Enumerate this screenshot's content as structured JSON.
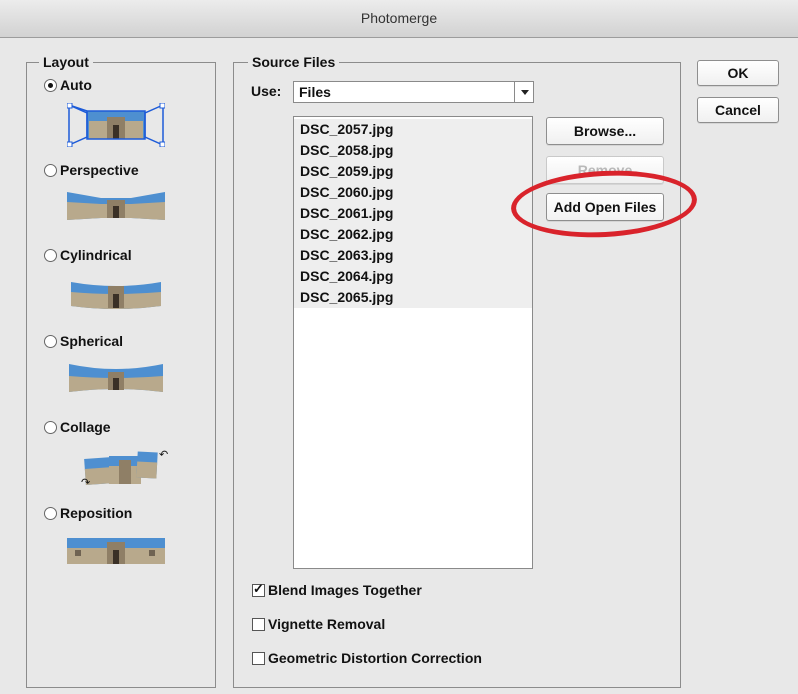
{
  "window": {
    "title": "Photomerge"
  },
  "layout": {
    "legend": "Layout",
    "options": [
      {
        "label": "Auto",
        "checked": true
      },
      {
        "label": "Perspective",
        "checked": false
      },
      {
        "label": "Cylindrical",
        "checked": false
      },
      {
        "label": "Spherical",
        "checked": false
      },
      {
        "label": "Collage",
        "checked": false
      },
      {
        "label": "Reposition",
        "checked": false
      }
    ]
  },
  "source": {
    "legend": "Source Files",
    "use_label": "Use:",
    "use_value": "Files",
    "files": [
      "DSC_2057.jpg",
      "DSC_2058.jpg",
      "DSC_2059.jpg",
      "DSC_2060.jpg",
      "DSC_2061.jpg",
      "DSC_2062.jpg",
      "DSC_2063.jpg",
      "DSC_2064.jpg",
      "DSC_2065.jpg"
    ],
    "browse_label": "Browse...",
    "remove_label": "Remove",
    "add_open_label": "Add Open Files"
  },
  "options": {
    "blend": {
      "label": "Blend Images Together",
      "checked": true
    },
    "vignette": {
      "label": "Vignette Removal",
      "checked": false
    },
    "geometric": {
      "label": "Geometric Distortion Correction",
      "checked": false
    }
  },
  "buttons": {
    "ok_label": "OK",
    "cancel_label": "Cancel"
  },
  "colors": {
    "highlight_circle": "#d9232b",
    "sky": "#4e8fd0",
    "building": "#b8a98c"
  }
}
